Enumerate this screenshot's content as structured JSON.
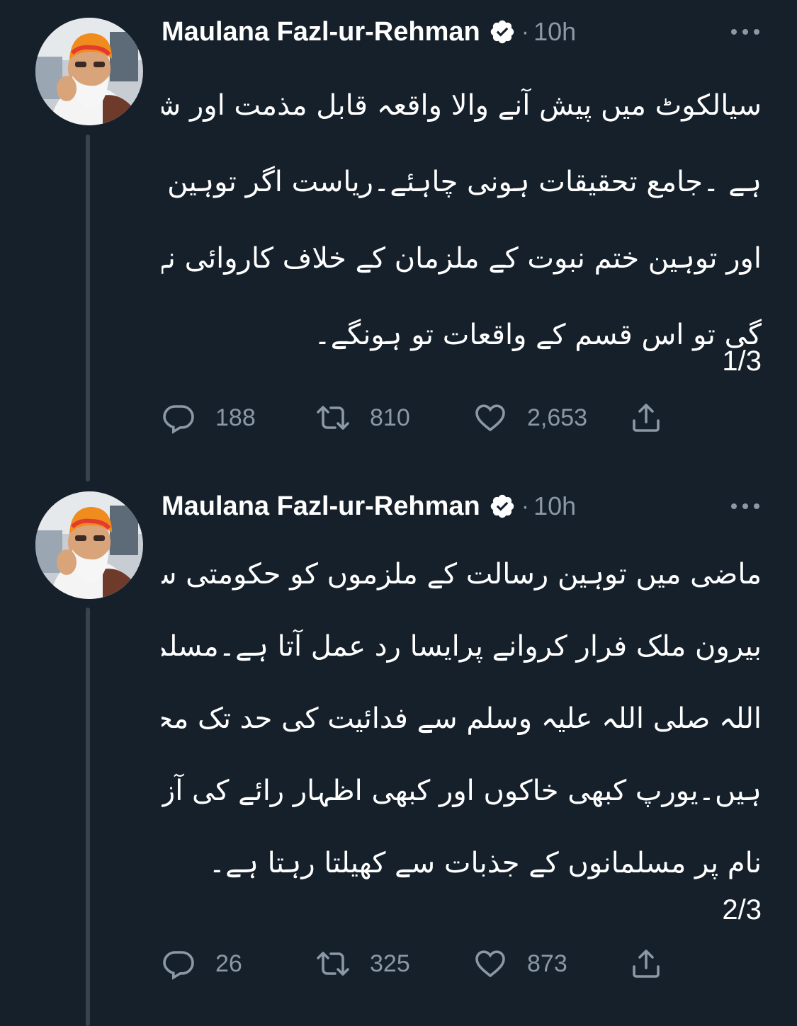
{
  "tweets": [
    {
      "author": "Maulana Fazl-ur-Rehman",
      "separator": "·",
      "time": "10h",
      "lines": [
        "سیالکوٹ میں پیش آنے والا واقعہ قابل مذمت اور شرمناک",
        "ہے ۔جامع تحقیقات ہونی چاہئے۔ریاست اگر توہین رسالت",
        "اور توہین ختم نبوت کے ملزمان کے خلاف کاروائی نہیں کرے",
        "گی تو اس قسم کے واقعات تو ہونگے۔"
      ],
      "counter": "1/3",
      "replies": "188",
      "retweets": "810",
      "likes": "2,653"
    },
    {
      "author": "Maulana Fazl-ur-Rehman",
      "separator": "·",
      "time": "10h",
      "lines": [
        "ماضی میں توہین رسالت کے ملزموں کو حکومتی سرپرستی میں",
        "بیرون ملک فرار کروانے پرایسا رد عمل آتا ہے۔مسلمان رسول",
        "اللہ صلی اللہ علیہ وسلم سے فدائیت کی حد تک محبت کرتے",
        "ہیں۔یورپ کبھی خاکوں اور کبھی اظہار رائے کی آزادی کے",
        "نام پر مسلمانوں کے جذبات سے کھیلتا رہتا ہے۔"
      ],
      "counter": "2/3",
      "replies": "26",
      "retweets": "325",
      "likes": "873"
    }
  ],
  "colors": {
    "background": "#15202b",
    "text": "#ffffff",
    "secondary": "#8b98a5",
    "thread_line": "#38444d"
  },
  "icons": {
    "verified": "verified-badge-icon",
    "more": "more-options-icon",
    "reply": "reply-icon",
    "retweet": "retweet-icon",
    "like": "heart-icon",
    "share": "share-icon"
  }
}
